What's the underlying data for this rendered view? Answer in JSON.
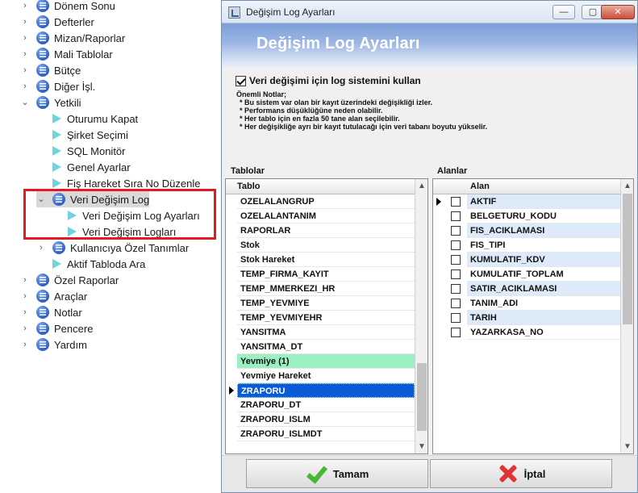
{
  "tree": {
    "items": [
      {
        "label": "Dönem Sonu",
        "level": 0,
        "chevron": "right",
        "icon": "menu-icon"
      },
      {
        "label": "Defterler",
        "level": 0,
        "chevron": "right",
        "icon": "menu-icon"
      },
      {
        "label": "Mizan/Raporlar",
        "level": 0,
        "chevron": "right",
        "icon": "menu-icon"
      },
      {
        "label": "Mali Tablolar",
        "level": 0,
        "chevron": "right",
        "icon": "menu-icon"
      },
      {
        "label": "Bütçe",
        "level": 0,
        "chevron": "right",
        "icon": "menu-icon"
      },
      {
        "label": "Diğer İşl.",
        "level": 0,
        "chevron": "right",
        "icon": "menu-icon"
      },
      {
        "label": "Yetkili",
        "level": 0,
        "chevron": "down",
        "icon": "menu-icon"
      },
      {
        "label": "Oturumu Kapat",
        "level": 1,
        "chevron": "",
        "icon": "play-icon"
      },
      {
        "label": "Şirket Seçimi",
        "level": 1,
        "chevron": "",
        "icon": "play-icon"
      },
      {
        "label": "SQL Monitör",
        "level": 1,
        "chevron": "",
        "icon": "play-icon"
      },
      {
        "label": "Genel Ayarlar",
        "level": 1,
        "chevron": "",
        "icon": "play-icon"
      },
      {
        "label": "Fiş Hareket Sıra No Düzenle",
        "level": 1,
        "chevron": "",
        "icon": "play-icon"
      },
      {
        "label": "Veri Değişim Log",
        "level": 1,
        "chevron": "down",
        "icon": "menu-icon"
      },
      {
        "label": "Veri Değişim Log Ayarları",
        "level": 2,
        "chevron": "",
        "icon": "play-icon"
      },
      {
        "label": "Veri Değişim Logları",
        "level": 2,
        "chevron": "",
        "icon": "play-icon"
      },
      {
        "label": "Kullanıcıya Özel Tanımlar",
        "level": 1,
        "chevron": "right",
        "icon": "menu-icon"
      },
      {
        "label": "Aktif Tabloda Ara",
        "level": 1,
        "chevron": "",
        "icon": "play-icon"
      },
      {
        "label": "Özel Raporlar",
        "level": 0,
        "chevron": "right",
        "icon": "menu-icon"
      },
      {
        "label": "Araçlar",
        "level": 0,
        "chevron": "right",
        "icon": "menu-icon"
      },
      {
        "label": "Notlar",
        "level": 0,
        "chevron": "right",
        "icon": "menu-icon"
      },
      {
        "label": "Pencere",
        "level": 0,
        "chevron": "right",
        "icon": "menu-icon"
      },
      {
        "label": "Yardım",
        "level": 0,
        "chevron": "right",
        "icon": "menu-icon"
      }
    ],
    "highlight_color": "#e21b23"
  },
  "dialog": {
    "window_title": "Değişim Log Ayarları",
    "banner_title": "Değişim Log Ayarları",
    "enable_label": "Veri değişimi için log sistemini kullan",
    "enable_checked": true,
    "notes_title": "Önemli Notlar;",
    "notes": [
      "Bu sistem var olan bir kayıt üzerindeki değişikliği izler.",
      "Performans düşüklüğüne neden olabilir.",
      "Her tablo için en fazla 50 tane alan seçilebilir.",
      "Her değişikliğe ayrı bir kayıt tutulacağı için veri tabanı boyutu yükselir."
    ],
    "tables_label": "Tablolar",
    "fields_label": "Alanlar",
    "tables_header": "Tablo",
    "tables": [
      {
        "name": "OZELALANGRUP",
        "style": ""
      },
      {
        "name": "OZELALANTANIM",
        "style": ""
      },
      {
        "name": "RAPORLAR",
        "style": ""
      },
      {
        "name": "Stok",
        "style": ""
      },
      {
        "name": "Stok Hareket",
        "style": ""
      },
      {
        "name": "TEMP_FIRMA_KAYIT",
        "style": ""
      },
      {
        "name": "TEMP_MMERKEZI_HR",
        "style": ""
      },
      {
        "name": "TEMP_YEVMIYE",
        "style": ""
      },
      {
        "name": "TEMP_YEVMIYEHR",
        "style": ""
      },
      {
        "name": "YANSITMA",
        "style": ""
      },
      {
        "name": "YANSITMA_DT",
        "style": ""
      },
      {
        "name": "Yevmiye (1)",
        "style": "green"
      },
      {
        "name": "Yevmiye Hareket",
        "style": ""
      },
      {
        "name": "ZRAPORU",
        "style": "selected"
      },
      {
        "name": "ZRAPORU_DT",
        "style": ""
      },
      {
        "name": "ZRAPORU_ISLM",
        "style": ""
      },
      {
        "name": "ZRAPORU_ISLMDT",
        "style": ""
      }
    ],
    "fields_header": "Alan",
    "fields": [
      {
        "name": "AKTIF",
        "checked": false,
        "current": true
      },
      {
        "name": "BELGETURU_KODU",
        "checked": false,
        "current": false
      },
      {
        "name": "FIS_ACIKLAMASI",
        "checked": false,
        "current": false
      },
      {
        "name": "FIS_TIPI",
        "checked": false,
        "current": false
      },
      {
        "name": "KUMULATIF_KDV",
        "checked": false,
        "current": false
      },
      {
        "name": "KUMULATIF_TOPLAM",
        "checked": false,
        "current": false
      },
      {
        "name": "SATIR_ACIKLAMASI",
        "checked": false,
        "current": false
      },
      {
        "name": "TANIM_ADI",
        "checked": false,
        "current": false
      },
      {
        "name": "TARIH",
        "checked": false,
        "current": false
      },
      {
        "name": "YAZARKASA_NO",
        "checked": false,
        "current": false
      }
    ],
    "ok_label": "Tamam",
    "cancel_label": "İptal"
  }
}
